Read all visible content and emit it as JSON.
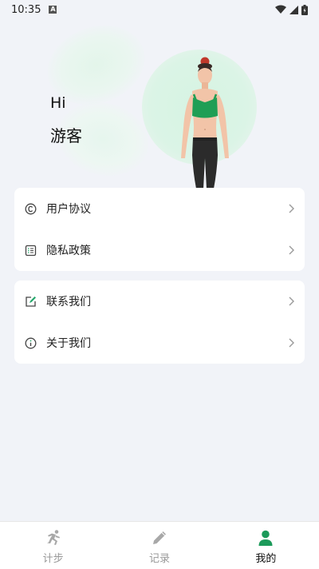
{
  "status": {
    "time": "10:35",
    "notif_glyph": "A"
  },
  "profile": {
    "greeting": "Hi",
    "username": "游客"
  },
  "menu_group_1": [
    {
      "label": "用户协议",
      "icon": "copyright-icon"
    },
    {
      "label": "隐私政策",
      "icon": "list-doc-icon"
    }
  ],
  "menu_group_2": [
    {
      "label": "联系我们",
      "icon": "edit-icon"
    },
    {
      "label": "关于我们",
      "icon": "info-icon"
    }
  ],
  "nav": {
    "items": [
      {
        "label": "计步",
        "icon": "runner-icon",
        "active": false
      },
      {
        "label": "记录",
        "icon": "pencil-icon",
        "active": false
      },
      {
        "label": "我的",
        "icon": "person-icon",
        "active": true
      }
    ]
  },
  "colors": {
    "accent": "#22a66a",
    "background": "#f1f3f8",
    "icon_gray": "#555555"
  }
}
